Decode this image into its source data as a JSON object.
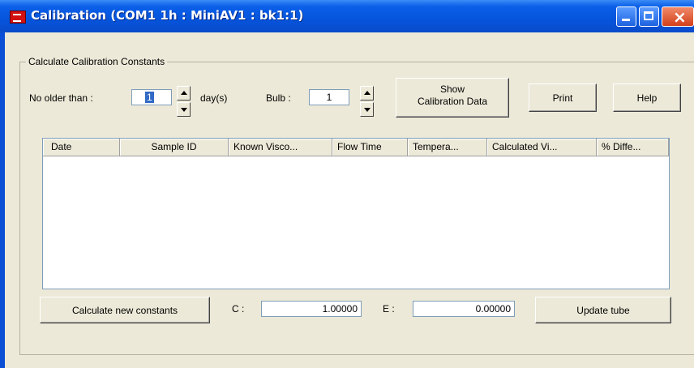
{
  "window": {
    "title": "Calibration (COM1 1h : MiniAV1 : bk1:1)",
    "accent": "#0a4fd6"
  },
  "group": {
    "label": "Calculate Calibration Constants"
  },
  "filters": {
    "no_older_label": "No older than :",
    "no_older_value": "1",
    "days_label": "day(s)",
    "bulb_label": "Bulb :",
    "bulb_value": "1"
  },
  "buttons": {
    "show_line1": "Show",
    "show_line2": "Calibration Data",
    "print": "Print",
    "help": "Help",
    "calculate": "Calculate new constants",
    "update": "Update tube"
  },
  "table": {
    "columns": [
      "Date",
      "Sample ID",
      "Known Visco...",
      "Flow Time",
      "Tempera...",
      "Calculated Vi...",
      "% Diffe..."
    ],
    "rows": []
  },
  "constants": {
    "c_label": "C :",
    "c_value": "1.00000",
    "e_label": "E :",
    "e_value": "0.00000"
  }
}
